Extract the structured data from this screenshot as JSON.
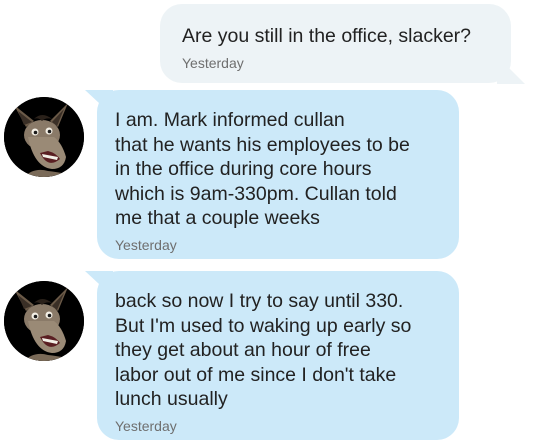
{
  "messages": [
    {
      "direction": "outgoing",
      "text": "Are you still in the office, slacker?",
      "time": "Yesterday"
    },
    {
      "direction": "incoming",
      "avatar_icon": "donkey-avatar",
      "text": "I am. Mark  informed cullan\nthat he wants his employees to be\nin the office during core hours\nwhich is 9am-330pm. Cullan told\nme that a couple weeks",
      "time": "Yesterday"
    },
    {
      "direction": "incoming",
      "avatar_icon": "donkey-avatar",
      "text": "back so now I try to say until 330.\nBut I'm used to waking up early so\nthey get about an hour of free\nlabor out of me since I don't take\nlunch usually",
      "time": "Yesterday"
    }
  ],
  "colors": {
    "outgoing_bubble": "#edf3f6",
    "incoming_bubble": "#cce9f9",
    "text": "#222222",
    "timestamp": "#6f6f6f"
  }
}
